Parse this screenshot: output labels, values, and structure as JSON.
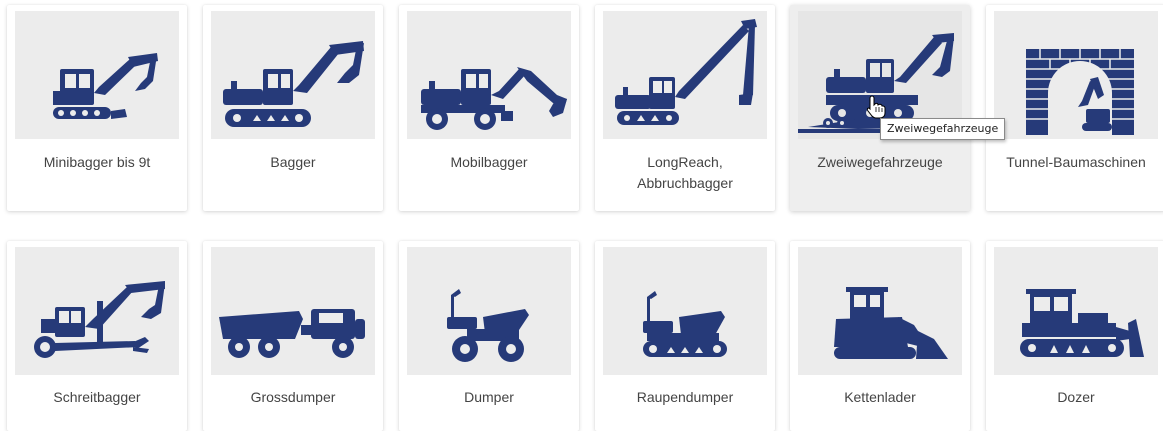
{
  "colors": {
    "icon": "#263a79",
    "thumb_bg": "#ececec",
    "card_hover": "#eeeeee"
  },
  "categories": [
    {
      "label": "Minibagger bis 9t",
      "icon": "mini-excavator-icon"
    },
    {
      "label": "Bagger",
      "icon": "excavator-icon"
    },
    {
      "label": "Mobilbagger",
      "icon": "wheeled-excavator-icon"
    },
    {
      "label": "LongReach, Abbruchbagger",
      "icon": "long-reach-excavator-icon"
    },
    {
      "label": "Zweiwegefahrzeuge",
      "icon": "rail-road-vehicle-icon",
      "hovered": true
    },
    {
      "label": "Tunnel-Baumaschinen",
      "icon": "tunnel-machine-icon"
    },
    {
      "label": "Schreitbagger",
      "icon": "walking-excavator-icon"
    },
    {
      "label": "Grossdumper",
      "icon": "articulated-dumper-icon"
    },
    {
      "label": "Dumper",
      "icon": "dumper-icon"
    },
    {
      "label": "Raupendumper",
      "icon": "tracked-dumper-icon"
    },
    {
      "label": "Kettenlader",
      "icon": "track-loader-icon"
    },
    {
      "label": "Dozer",
      "icon": "dozer-icon"
    }
  ],
  "tooltip": {
    "text": "Zweiwegefahrzeuge"
  }
}
